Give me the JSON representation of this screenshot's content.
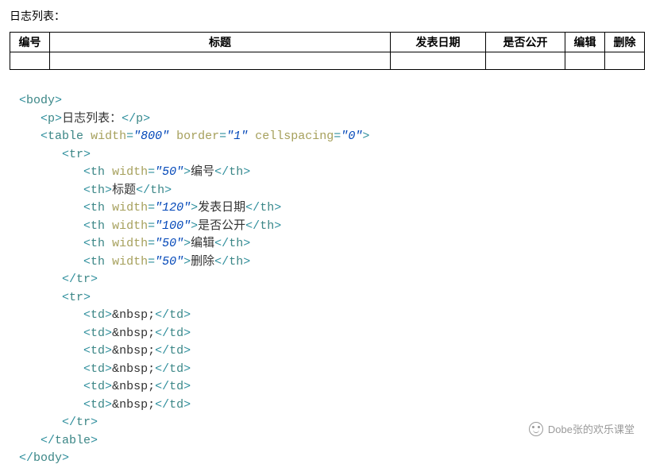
{
  "preview": {
    "title": "日志列表：",
    "headers": [
      "编号",
      "标题",
      "发表日期",
      "是否公开",
      "编辑",
      "删除"
    ],
    "widths": [
      50,
      null,
      120,
      100,
      50,
      50
    ],
    "empty_cells": [
      " ",
      " ",
      " ",
      " ",
      " ",
      " "
    ]
  },
  "code": {
    "table_attrs": {
      "width": "800",
      "border": "1",
      "cellspacing": "0"
    },
    "th_rows": [
      {
        "width": "50",
        "text": "编号"
      },
      {
        "width": null,
        "text": "标题"
      },
      {
        "width": "120",
        "text": "发表日期"
      },
      {
        "width": "100",
        "text": "是否公开"
      },
      {
        "width": "50",
        "text": "编辑"
      },
      {
        "width": "50",
        "text": "删除"
      }
    ],
    "td_content": "&nbsp;",
    "p_text": "日志列表："
  },
  "watermark": {
    "text": "Dobe张的欢乐课堂"
  }
}
